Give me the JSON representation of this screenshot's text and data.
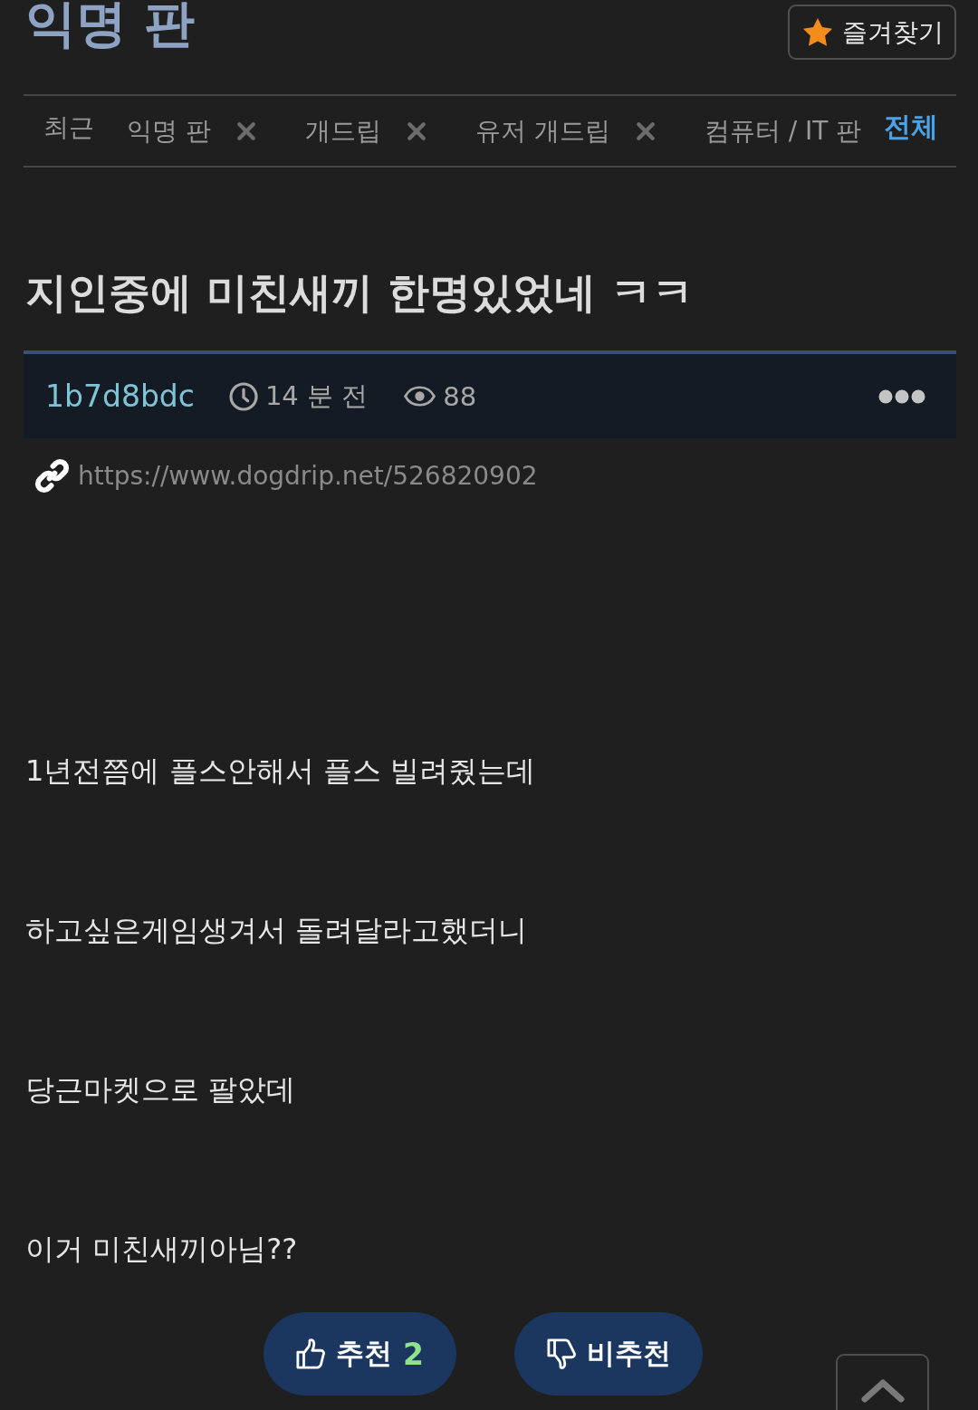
{
  "board": {
    "title": "익명 판"
  },
  "favorite_button": {
    "label": "즐겨찾기"
  },
  "recent_bar": {
    "label": "최근",
    "items": [
      {
        "label": "익명 판",
        "removable": true
      },
      {
        "label": "개드립",
        "removable": true
      },
      {
        "label": "유저 개드립",
        "removable": true
      },
      {
        "label": "컴퓨터 / IT 판",
        "removable": false
      }
    ],
    "all_link": "전체"
  },
  "post": {
    "title": "지인중에 미친새끼 한명있었네 ㅋㅋ",
    "author": "1b7d8bdc",
    "time": "14 분 전",
    "views": "88",
    "url": "https://www.dogdrip.net/526820902",
    "paragraphs": [
      "1년전쯤에 플스안해서 플스 빌려줬는데",
      "하고싶은게임생겨서 돌려달라고했더니",
      "당근마켓으로 팔았데",
      "이거 미친새끼아님??"
    ]
  },
  "votes": {
    "upvote": {
      "label": "추천",
      "count": "2"
    },
    "downvote": {
      "label": "비추천"
    }
  }
}
